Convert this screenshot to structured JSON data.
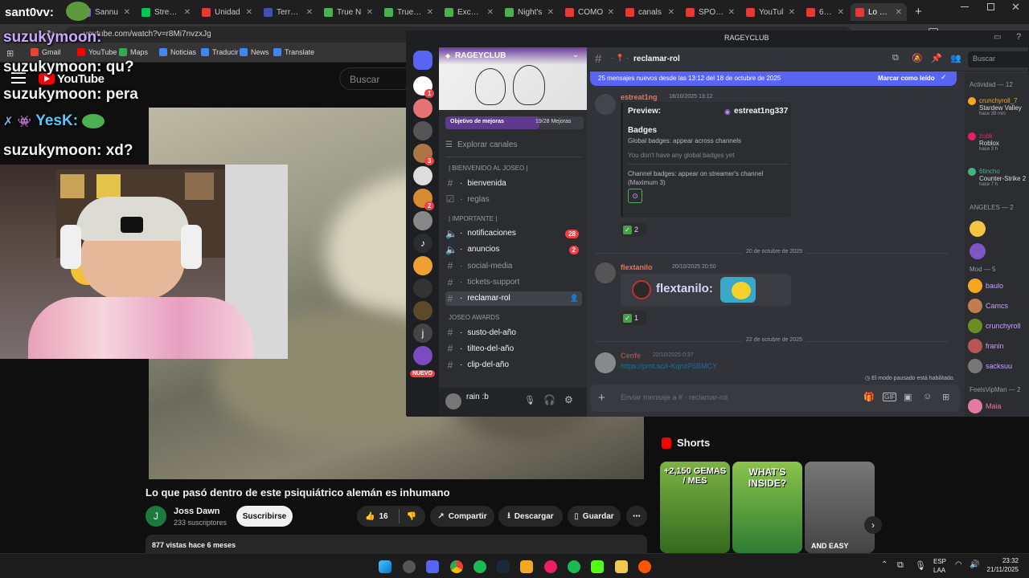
{
  "browser": {
    "tabs": [
      {
        "label": "sant0vv:",
        "color": "#46a05a"
      },
      {
        "label": "Sannu",
        "color": "#9147ff"
      },
      {
        "label": "Stream",
        "color": "#00c853"
      },
      {
        "label": "Unidad",
        "color": "#e53935"
      },
      {
        "label": "Terra B",
        "color": "#3f51b5"
      },
      {
        "label": "True N",
        "color": "#4caf50"
      },
      {
        "label": "True Ex",
        "color": "#4caf50"
      },
      {
        "label": "Excalib",
        "color": "#4caf50"
      },
      {
        "label": "Night's",
        "color": "#4caf50"
      },
      {
        "label": "COMO",
        "color": "#e53935"
      },
      {
        "label": "canals",
        "color": "#e53935"
      },
      {
        "label": "SPOTIF",
        "color": "#e53935"
      },
      {
        "label": "YouTul",
        "color": "#e53935"
      },
      {
        "label": "6 TIPS",
        "color": "#e53935"
      },
      {
        "label": "Lo que",
        "color": "#e53935"
      }
    ],
    "new_tab": "+",
    "url": "youtube.com/watch?v=r8Mi7nvzxJg",
    "bookmarks": [
      "Gmail",
      "YouTube",
      "Maps",
      "Noticias",
      "Traducir",
      "News",
      "Translate"
    ]
  },
  "overlay_chat": [
    {
      "user": "suzukymoon:",
      "msg": ""
    },
    {
      "user": "suzukymoon:",
      "msg": " qu?"
    },
    {
      "user": "suzukymoon:",
      "msg": " pera"
    },
    {
      "user": "YesK:",
      "msg": ""
    },
    {
      "user": "suzukymoon:",
      "msg": " xd?"
    }
  ],
  "youtube": {
    "logo": "YouTube",
    "search_placeholder": "Buscar",
    "title": "Lo que pasó dentro de este psiquiátrico alemán es inhumano",
    "channel": "Joss Dawn",
    "subs": "233 suscriptores",
    "avatar_letter": "J",
    "subscribe": "Suscribirse",
    "likes": "16",
    "share": "Compartir",
    "download": "Descargar",
    "save": "Guardar",
    "more": "⋯",
    "views": "877 vistas  hace 6 meses",
    "shorts_title": "Shorts",
    "shorts": [
      {
        "overlay": "+2,150 GEMAS / MES",
        "color": "#4a7a2a"
      },
      {
        "overlay": "WHAT'S INSIDE?",
        "color": "#6aa84f"
      },
      {
        "overlay": "AND EASY",
        "color": "#5a5a5a"
      }
    ]
  },
  "discord": {
    "window_title": "RAGEYCLUB",
    "server_name": "RAGEYCLUB",
    "boost": {
      "label": "Objetivo de mejoras",
      "progress": "19/28 Mejoras",
      "fraction": 0.68
    },
    "explore": "Explorar canales",
    "categories": [
      {
        "name": "| BIENVENIDO AL JOSEO |",
        "channels": [
          {
            "name": "bienvenida",
            "bright": true,
            "icon": "hash"
          },
          {
            "name": "reglas",
            "bright": false,
            "icon": "rules"
          }
        ]
      },
      {
        "name": "| IMPORTANTE |",
        "channels": [
          {
            "name": "notificaciones",
            "bright": true,
            "icon": "speaker",
            "badge": "28"
          },
          {
            "name": "anuncios",
            "bright": true,
            "icon": "speaker",
            "badge": "2"
          },
          {
            "name": "social-media",
            "bright": false,
            "icon": "hash"
          },
          {
            "name": "tickets-support",
            "bright": false,
            "icon": "hash"
          },
          {
            "name": "reclamar-rol",
            "bright": true,
            "icon": "hash",
            "selected": true
          }
        ]
      },
      {
        "name": "JOSEO AWARDS",
        "channels": [
          {
            "name": "susto-del-año",
            "bright": true,
            "icon": "hash"
          },
          {
            "name": "tilteo-del-año",
            "bright": true,
            "icon": "hash"
          },
          {
            "name": "clip-del-año",
            "bright": true,
            "icon": "hash"
          }
        ]
      }
    ],
    "user": "rain :b",
    "channel_header": "reclamar-rol",
    "search_placeholder": "Buscar",
    "new_messages_bar": "25 mensajes nuevos desde las 13:12 del 18 de octubre de 2025",
    "mark_read": "Marcar como leído",
    "messages": [
      {
        "author": "estreat1ng",
        "time": "18/10/2025 13:12",
        "color": "#f26f56"
      },
      {
        "author": "flextanilo",
        "time": "20/10/2025 20:50",
        "color": "#f26f56"
      },
      {
        "author": "Cenfe",
        "time": "22/10/2025 0:37",
        "color": "#f26f56"
      }
    ],
    "embed": {
      "preview_label": "Preview:",
      "preview_user": "estreat1ng337",
      "heading": "Badges",
      "global": "Global badges: appear across channels",
      "no_global": "You don't have any global badges yet",
      "channel": "Channel badges: appear on streamer's channel (Maximum 3)"
    },
    "reactions": [
      "2",
      "1"
    ],
    "dividers": [
      "20 de octubre de 2025",
      "22 de octubre de 2025"
    ],
    "flex_text": "flextanilo:",
    "link": "https://prnt.sc/r-KqnzP6BMCY",
    "slowmode": "El modo pausado está habilitado.",
    "composer_placeholder": "Enviar mensaje a # · reclamar-rol",
    "members": {
      "activity": "Actividad — 12",
      "activity_list": [
        {
          "name": "crunchyroll_7",
          "game": "Stardew Valley",
          "sub": "hace 39 min",
          "color": "#f5a623"
        },
        {
          "name": "zobk",
          "game": "Roblox",
          "sub": "hace 3 h",
          "color": "#e91e63"
        },
        {
          "name": "6tincho",
          "game": "Counter-Strike 2",
          "sub": "hace 7 h",
          "color": "#43b581"
        }
      ],
      "angeles": "ANGELES — 2",
      "mod": "Mod — 5",
      "mods": [
        {
          "name": "baulo",
          "color": "#f5a623"
        },
        {
          "name": "Camcs",
          "color": "#c27c4e"
        },
        {
          "name": "crunchyroll",
          "color": "#6b8e23"
        },
        {
          "name": "franin",
          "color": "#b85454"
        },
        {
          "name": "sacksuu",
          "color": "#777"
        }
      ],
      "feels": "FeelsVipMan — 2",
      "last": "Maia"
    }
  },
  "taskbar": {
    "lang": "ESP",
    "lang2": "LAA",
    "time": "23:32",
    "date": "21/11/2025"
  }
}
